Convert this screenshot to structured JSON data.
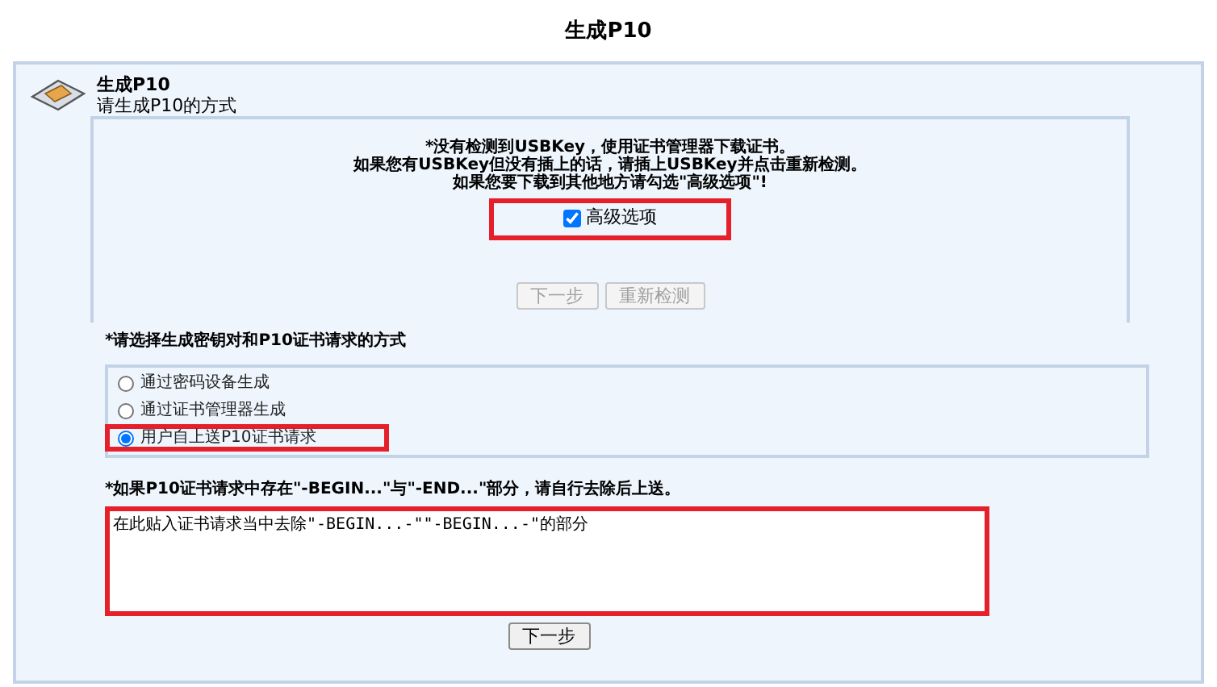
{
  "page_title": "生成P10",
  "panel": {
    "title": "生成P10",
    "subtitle": "请生成P10的方式"
  },
  "notice": {
    "lines": [
      "*没有检测到USBKey，使用证书管理器下载证书。",
      "如果您有USBKey但没有插上的话，请插上USBKey并点击重新检测。",
      "如果您要下载到其他地方请勾选\"高级选项\"!"
    ],
    "checkbox": {
      "label": "高级选项",
      "checked": true,
      "highlighted": true
    },
    "buttons": [
      {
        "label": "下一步",
        "disabled": true
      },
      {
        "label": "重新检测",
        "disabled": true
      }
    ]
  },
  "method": {
    "label": "*请选择生成密钥对和P10证书请求的方式",
    "options": [
      {
        "label": "通过密码设备生成",
        "selected": false,
        "highlighted": false
      },
      {
        "label": "通过证书管理器生成",
        "selected": false,
        "highlighted": false
      },
      {
        "label": "用户自上送P10证书请求",
        "selected": true,
        "highlighted": true
      }
    ]
  },
  "request": {
    "label": "*如果P10证书请求中存在\"-BEGIN...\"与\"-END...\"部分，请自行去除后上送。",
    "value": "在此贴入证书请求当中去除\"-BEGIN...-\"\"-BEGIN...-\"的部分",
    "highlighted": true
  },
  "submit": {
    "label": "下一步",
    "disabled": false
  }
}
